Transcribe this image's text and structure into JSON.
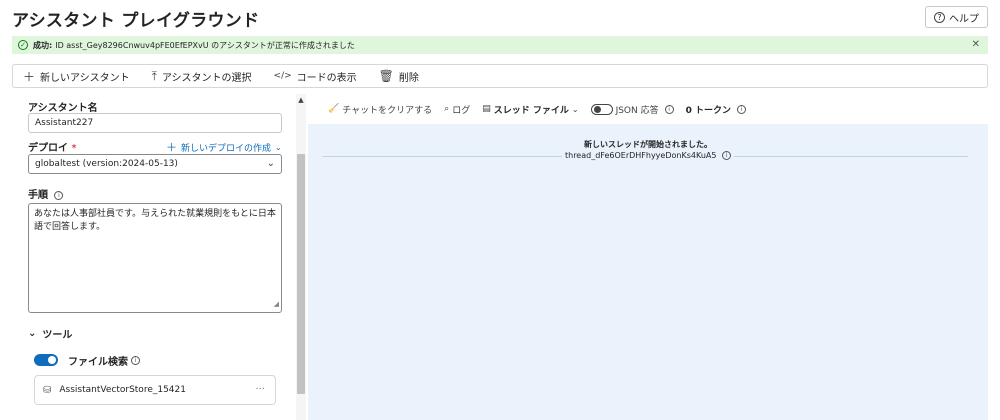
{
  "header": {
    "title": "アシスタント プレイグラウンド",
    "help_label": "ヘルプ"
  },
  "notification": {
    "strong": "成功:",
    "message": "ID asst_Gey8296Cnwuv4pFE0EfEPXvU のアシスタントが正常に作成されました"
  },
  "toolbar": {
    "new_assistant": "新しいアシスタント",
    "select_assistant": "アシスタントの選択",
    "view_code": "コードの表示",
    "delete": "削除"
  },
  "form": {
    "name_label": "アシスタント名",
    "name_value": "Assistant227",
    "deploy_label": "デプロイ",
    "deploy_required": "*",
    "new_deploy": "新しいデプロイの作成",
    "deploy_value": "globaltest (version:2024-05-13)",
    "instructions_label": "手順",
    "instructions_value": "あなたは人事部社員です。与えられた就業規則をもとに日本語で回答します。",
    "tools_label": "ツール",
    "file_search_label": "ファイル検索",
    "vector_store": "AssistantVectorStore_15421"
  },
  "chat_toolbar": {
    "clear_chat": "チャットをクリアする",
    "logs": "ログ",
    "thread_files": "スレッド ファイル",
    "json_label": "JSON 応答",
    "tokens": "0 トークン"
  },
  "chat": {
    "new_thread": "新しいスレッドが開始されました。",
    "thread_id": "thread_dFe6OErDHFhyyeDonKs4KuA5"
  },
  "colors": {
    "accent": "#0f6cbd",
    "success_bg": "#dff6dd",
    "chat_bg": "#eaf2fb"
  }
}
